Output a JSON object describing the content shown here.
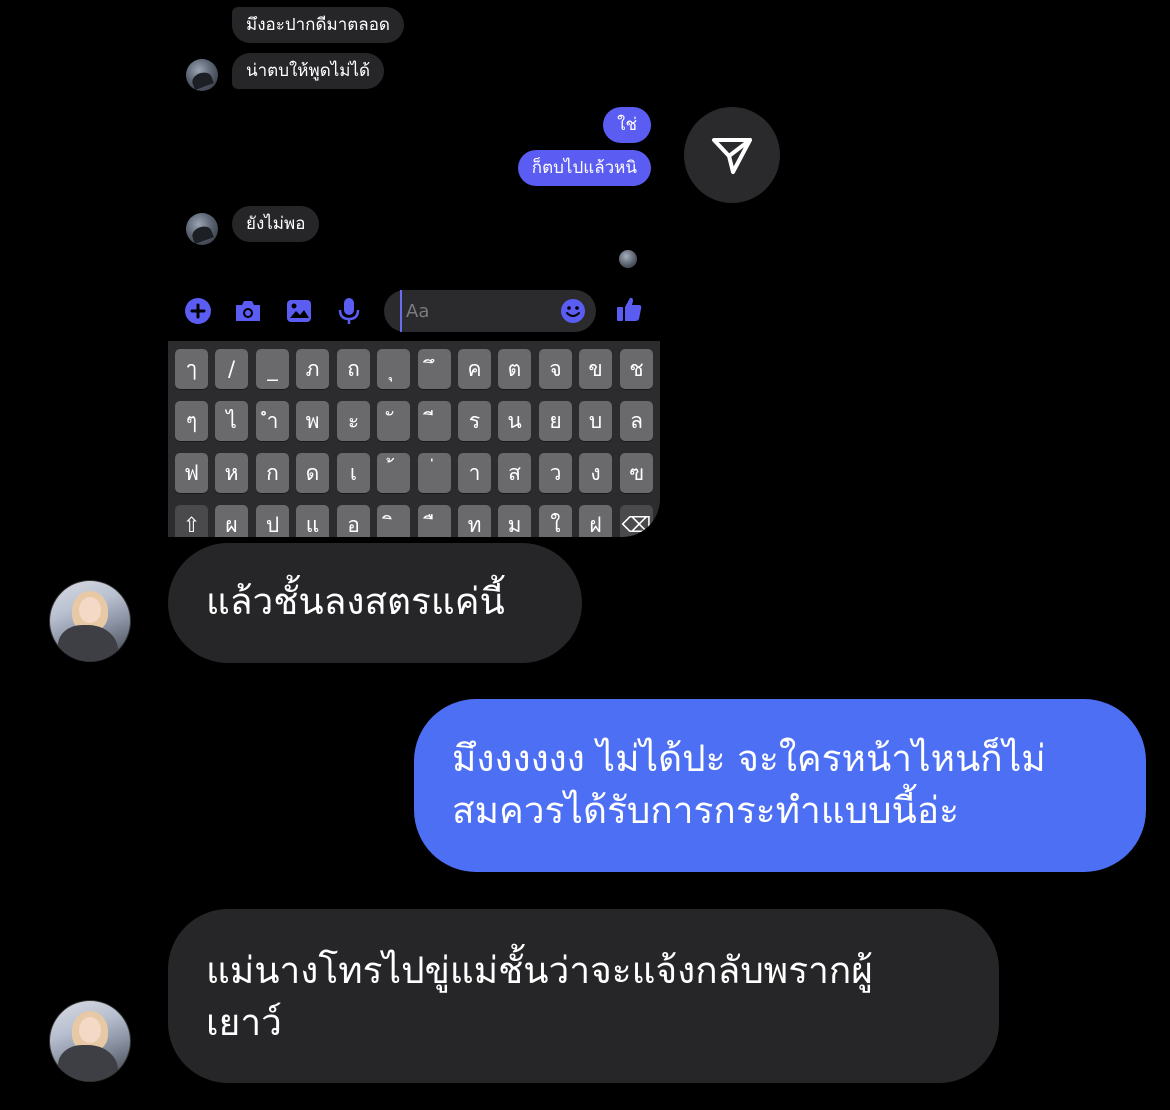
{
  "mini_thread": {
    "messages": [
      {
        "side": "in",
        "text": "มึงอะปากดีมาตลอด"
      },
      {
        "side": "in",
        "text": "น่าตบให้พูดไม่ได้"
      },
      {
        "side": "out",
        "text": "ใช่"
      },
      {
        "side": "out",
        "text": "ก็ตบไปแล้วหนิ"
      },
      {
        "side": "in",
        "text": "ยังไม่พอ"
      }
    ]
  },
  "composer": {
    "placeholder": "Aa",
    "icons": [
      "plus-circle-icon",
      "camera-icon",
      "image-icon",
      "microphone-icon",
      "emoji-icon",
      "thumbs-up-icon"
    ],
    "accent_color": "#5b5cf2"
  },
  "share_button": {
    "icon": "send-paper-plane-icon"
  },
  "keyboard": {
    "rows": [
      [
        "ๅ",
        "/",
        "_",
        "ภ",
        "ถ",
        "ุ",
        "ึ",
        "ค",
        "ต",
        "จ",
        "ข",
        "ช"
      ],
      [
        "ๆ",
        "ไ",
        "ำ",
        "พ",
        "ะ",
        "ั",
        "ี",
        "ร",
        "น",
        "ย",
        "บ",
        "ล"
      ],
      [
        "ฟ",
        "ห",
        "ก",
        "ด",
        "เ",
        "้",
        "่",
        "า",
        "ส",
        "ว",
        "ง",
        "ฃ"
      ],
      [
        "⇧",
        "ผ",
        "ป",
        "แ",
        "อ",
        "ิ",
        "ื",
        "ท",
        "ม",
        "ใ",
        "ฝ",
        "⌫"
      ]
    ]
  },
  "main_thread": {
    "messages": [
      {
        "side": "in",
        "text": "แล้วชั้นลงสตรแค่นี้"
      },
      {
        "side": "out",
        "text": "มึงงงงงง ไม่ได้ปะ จะใครหน้าไหนก็ไม่\nสมควรได้รับการกระทำแบบนี้อ่ะ"
      },
      {
        "side": "in",
        "text": "แม่นางโทรไปขู่แม่ชั้นว่าจะแจ้งกลับพรากผู้\nเยาว์"
      }
    ]
  },
  "colors": {
    "incoming_bubble": "#262628",
    "outgoing_bubble": "#4d6ff3",
    "mini_outgoing_bubble": "#5b5cf2",
    "background": "#000000"
  }
}
